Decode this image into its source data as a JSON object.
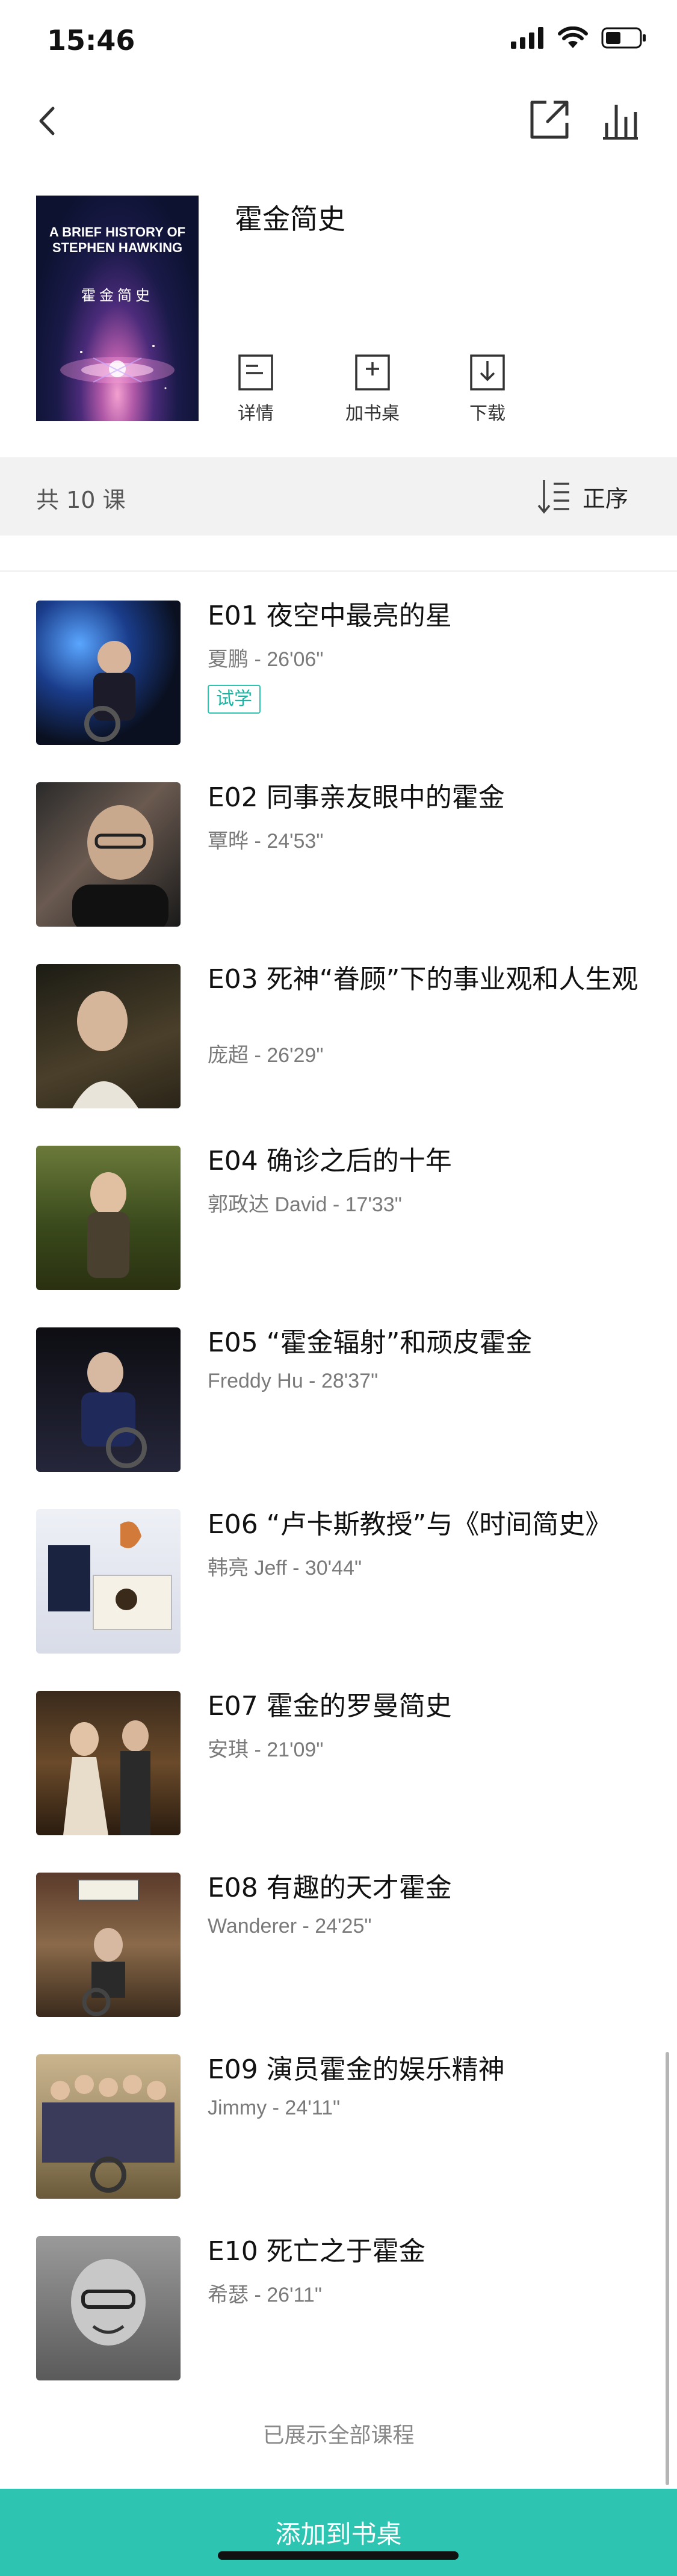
{
  "status_bar": {
    "time": "15:46"
  },
  "book": {
    "title": "霍金简史",
    "cover": {
      "title_en_line1": "A BRIEF HISTORY OF",
      "title_en_line2": "STEPHEN HAWKING",
      "title_cn": "霍金简史"
    },
    "actions": [
      {
        "label": "详情",
        "icon": "details-icon"
      },
      {
        "label": "加书桌",
        "icon": "add-to-desk-icon"
      },
      {
        "label": "下载",
        "icon": "download-icon"
      }
    ]
  },
  "list_header": {
    "count_label": "共 10 课",
    "sort_label": "正序"
  },
  "episodes": [
    {
      "title": "E01 夜空中最亮的星",
      "meta": "夏鹏 - 26'06\"",
      "badge": "试学"
    },
    {
      "title": "E02 同事亲友眼中的霍金",
      "meta": "覃晔 - 24'53\""
    },
    {
      "title": "E03 死神“眷顾”下的事业观和人生观",
      "meta": "庞超 - 26'29\""
    },
    {
      "title": "E04 确诊之后的十年",
      "meta": "郭政达 David - 17'33\""
    },
    {
      "title": "E05 “霍金辐射”和顽皮霍金",
      "meta": "Freddy Hu - 28'37\""
    },
    {
      "title": "E06 “卢卡斯教授”与《时间简史》",
      "meta": "韩亮 Jeff - 30'44\""
    },
    {
      "title": "E07 霍金的罗曼简史",
      "meta": "安琪 - 21'09\""
    },
    {
      "title": "E08 有趣的天才霍金",
      "meta": "Wanderer - 24'25\""
    },
    {
      "title": "E09 演员霍金的娱乐精神",
      "meta": "Jimmy - 24'11\""
    },
    {
      "title": "E10 死亡之于霍金",
      "meta": "希瑟 - 26'11\""
    }
  ],
  "footer_note": "已展示全部课程",
  "add_to_shelf_label": "添加到书桌",
  "colors": {
    "accent": "#2ec4b2",
    "count_bar_bg": "#f2f2f2"
  }
}
